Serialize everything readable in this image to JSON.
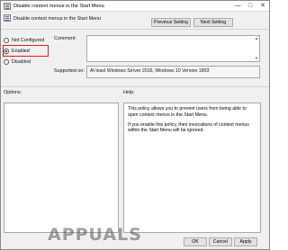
{
  "window": {
    "title": "Disable context menus in the Start Menu",
    "minimize_glyph": "—",
    "maximize_glyph": "□",
    "close_glyph": "✕"
  },
  "toolbar": {
    "policy_name": "Disable context menus in the Start Menu",
    "previous_label": "Previous Setting",
    "next_label": "Next Setting"
  },
  "state": {
    "options": [
      {
        "label": "Not Configured",
        "checked": false
      },
      {
        "label": "Enabled",
        "checked": true
      },
      {
        "label": "Disabled",
        "checked": false
      }
    ],
    "highlight_color": "#e01b1b"
  },
  "comment": {
    "label": "Comment:",
    "value": ""
  },
  "supported": {
    "label": "Supported on:",
    "value": "At least Windows Server 2016, Windows 10 Version 1803"
  },
  "options_pane": {
    "label": "Options:"
  },
  "help_pane": {
    "label": "Help:",
    "paragraphs": [
      "This policy allows you to prevent users from being able to open context menus in the Start Menu.",
      "If you enable this policy, then invocations of context menus within the Start Menu will be ignored."
    ]
  },
  "footer": {
    "ok_label": "OK",
    "cancel_label": "Cancel",
    "apply_label": "Apply"
  },
  "watermark": "APPUALS"
}
